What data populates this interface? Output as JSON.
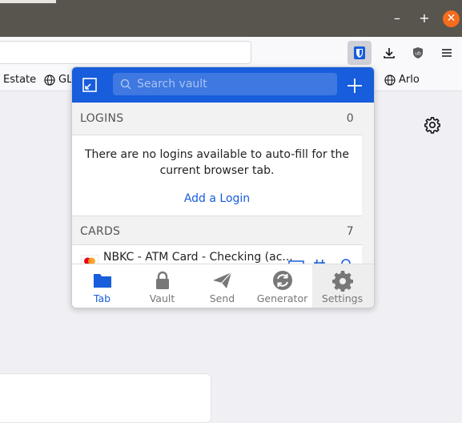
{
  "window": {
    "minimize": "–",
    "maximize": "+",
    "close": "✕"
  },
  "bookmarks": [
    {
      "label": "Estate",
      "icon": ""
    },
    {
      "label": "GL",
      "icon": "globe-icon"
    },
    {
      "label": "Arlo",
      "icon": "globe-icon"
    }
  ],
  "popup": {
    "search_placeholder": "Search vault",
    "logins": {
      "label": "LOGINS",
      "count": "0"
    },
    "empty_message": "There are no logins available to auto-fill for the current browser tab.",
    "add_login": "Add a Login",
    "cards": {
      "label": "CARDS",
      "count": "7"
    },
    "card_items": [
      {
        "name": "NBKC - ATM Card - Checking (ac..."
      }
    ],
    "tabs": [
      {
        "label": "Tab",
        "icon": "folder-icon",
        "active": true
      },
      {
        "label": "Vault",
        "icon": "lock-icon",
        "active": false
      },
      {
        "label": "Send",
        "icon": "send-icon",
        "active": false
      },
      {
        "label": "Generator",
        "icon": "refresh-icon",
        "active": false
      },
      {
        "label": "Settings",
        "icon": "gear-icon",
        "active": false
      }
    ]
  },
  "colors": {
    "brand": "#175ddc",
    "titlebar": "#58544e",
    "close": "#f46c1d"
  }
}
